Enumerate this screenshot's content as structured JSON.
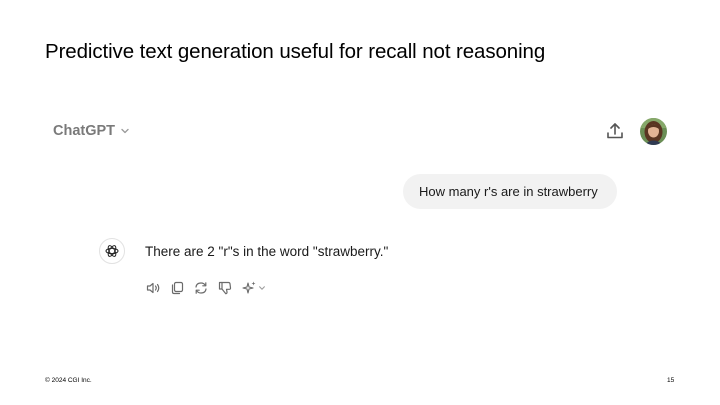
{
  "slide": {
    "title": "Predictive text generation useful for recall not reasoning",
    "footer": "© 2024 CGI Inc.",
    "page_number": "15"
  },
  "chat": {
    "header": {
      "title": "ChatGPT",
      "title_icon": "chevron-down-icon",
      "share_icon": "share-upload-icon",
      "avatar_icon": "user-avatar"
    },
    "messages": [
      {
        "role": "user",
        "text": "How many r's are in strawberry"
      },
      {
        "role": "assistant",
        "text": "There are 2 \"r\"s in the word \"strawberry.\""
      }
    ],
    "message_actions": [
      "read-aloud-icon",
      "copy-icon",
      "regenerate-icon",
      "thumbs-down-icon",
      "sparkle-icon",
      "chevron-down-icon"
    ]
  },
  "colors": {
    "header_text": "#7a7a7a",
    "bubble_bg": "#f2f2f2",
    "icon": "#6b6b6b",
    "text": "#1a1a1a"
  }
}
